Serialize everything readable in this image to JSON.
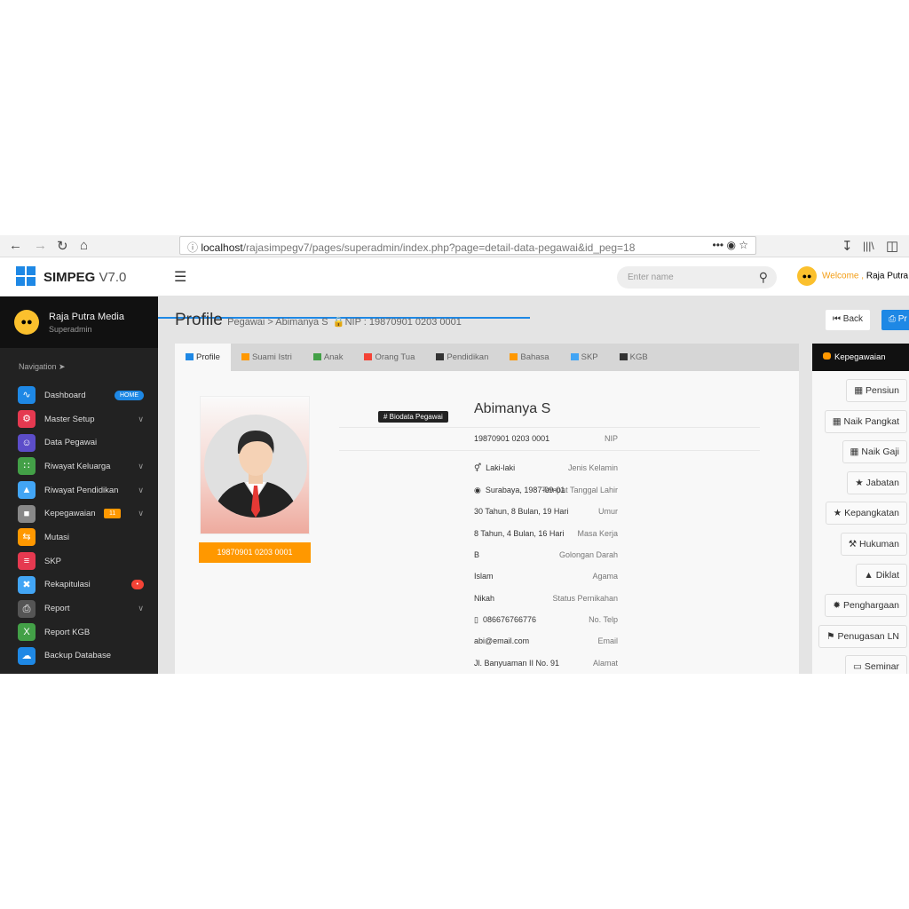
{
  "browser": {
    "url_host": "localhost",
    "url_path": "/rajasimpegv7/pages/superadmin/index.php?page=detail-data-pegawai&id_peg=18"
  },
  "app": {
    "brand": "SIMPEG",
    "version": "V7.0",
    "search_placeholder": "Enter name",
    "welcome": "Welcome ,",
    "welcome_user": "Raja Putra M"
  },
  "user": {
    "name": "Raja Putra Media",
    "role": "Superadmin"
  },
  "sidebar": {
    "nav_label": "Navigation",
    "items": [
      {
        "label": "Dashboard",
        "icon": "pulse-icon",
        "color": "#1e88e5",
        "badge": "HOME",
        "badge_color": "#1e88e5"
      },
      {
        "label": "Master Setup",
        "icon": "gear-icon",
        "color": "#e53950",
        "chevron": true
      },
      {
        "label": "Data Pegawai",
        "icon": "user-icon",
        "color": "#5c4dc9"
      },
      {
        "label": "Riwayat Keluarga",
        "icon": "family-icon",
        "color": "#43a047",
        "chevron": true
      },
      {
        "label": "Riwayat Pendidikan",
        "icon": "graduation-icon",
        "color": "#42a5f5",
        "chevron": true
      },
      {
        "label": "Kepegawaian",
        "icon": "briefcase-icon",
        "color": "#888888",
        "badge": "11",
        "badge_color": "#ff9800",
        "chevron": true
      },
      {
        "label": "Mutasi",
        "icon": "exchange-icon",
        "color": "#ff9800"
      },
      {
        "label": "SKP",
        "icon": "layers-icon",
        "color": "#e53950"
      },
      {
        "label": "Rekapitulasi",
        "icon": "compress-icon",
        "color": "#42a5f5",
        "badge": "•",
        "badge_color": "#f44336"
      },
      {
        "label": "Report",
        "icon": "printer-icon",
        "color": "#555555",
        "chevron": true
      },
      {
        "label": "Report KGB",
        "icon": "excel-icon",
        "color": "#43a047"
      },
      {
        "label": "Backup Database",
        "icon": "cloud-icon",
        "color": "#1e88e5"
      }
    ]
  },
  "page": {
    "title": "Profile",
    "breadcrumb": "Pegawai > Abimanya S",
    "nip_label": "NIP : 19870901 0203 0001",
    "back": "Back",
    "print": "Pr"
  },
  "tabs": [
    {
      "label": "Profile",
      "color": "#1e88e5",
      "active": true
    },
    {
      "label": "Suami Istri",
      "color": "#ff9800"
    },
    {
      "label": "Anak",
      "color": "#43a047"
    },
    {
      "label": "Orang Tua",
      "color": "#f44336"
    },
    {
      "label": "Pendidikan",
      "color": "#333333"
    },
    {
      "label": "Bahasa",
      "color": "#ff9800"
    },
    {
      "label": "SKP",
      "color": "#42a5f5"
    },
    {
      "label": "KGB",
      "color": "#333333"
    }
  ],
  "profile": {
    "nip_button": "19870901 0203 0001",
    "section_badge": "# Biodata Pegawai",
    "name": "Abimanya S",
    "fields": [
      {
        "label": "NIP",
        "value": "19870901 0203 0001"
      },
      {
        "label": "Jenis Kelamin",
        "value": "Laki-laki",
        "icon": "gender-male-icon"
      },
      {
        "label": "Tempat Tanggal Lahir",
        "value": "Surabaya, 1987-09-01",
        "icon": "map-marker-icon"
      },
      {
        "label": "Umur",
        "value": "30 Tahun, 8 Bulan, 19 Hari"
      },
      {
        "label": "Masa Kerja",
        "value": "8 Tahun, 4 Bulan, 16 Hari"
      },
      {
        "label": "Golongan Darah",
        "value": "B"
      },
      {
        "label": "Agama",
        "value": "Islam"
      },
      {
        "label": "Status Pernikahan",
        "value": "Nikah"
      },
      {
        "label": "No. Telp",
        "value": "086676766776",
        "icon": "phone-icon"
      },
      {
        "label": "Email",
        "value": "abi@email.com"
      },
      {
        "label": "Alamat",
        "value": "Jl. Banyuaman II No. 91"
      }
    ]
  },
  "right_panel": {
    "title": "Kepegawaian",
    "buttons": [
      {
        "label": "Pensiun",
        "icon": "calendar-icon"
      },
      {
        "label": "Naik Pangkat",
        "icon": "calendar-icon"
      },
      {
        "label": "Naik Gaji",
        "icon": "calendar-icon"
      },
      {
        "label": "Jabatan",
        "icon": "star-icon"
      },
      {
        "label": "Kepangkatan",
        "icon": "star-icon"
      },
      {
        "label": "Hukuman",
        "icon": "gavel-icon"
      },
      {
        "label": "Diklat",
        "icon": "graduation-icon"
      },
      {
        "label": "Penghargaan",
        "icon": "certificate-icon"
      },
      {
        "label": "Penugasan LN",
        "icon": "flag-icon"
      },
      {
        "label": "Seminar",
        "icon": "desktop-icon"
      }
    ]
  }
}
